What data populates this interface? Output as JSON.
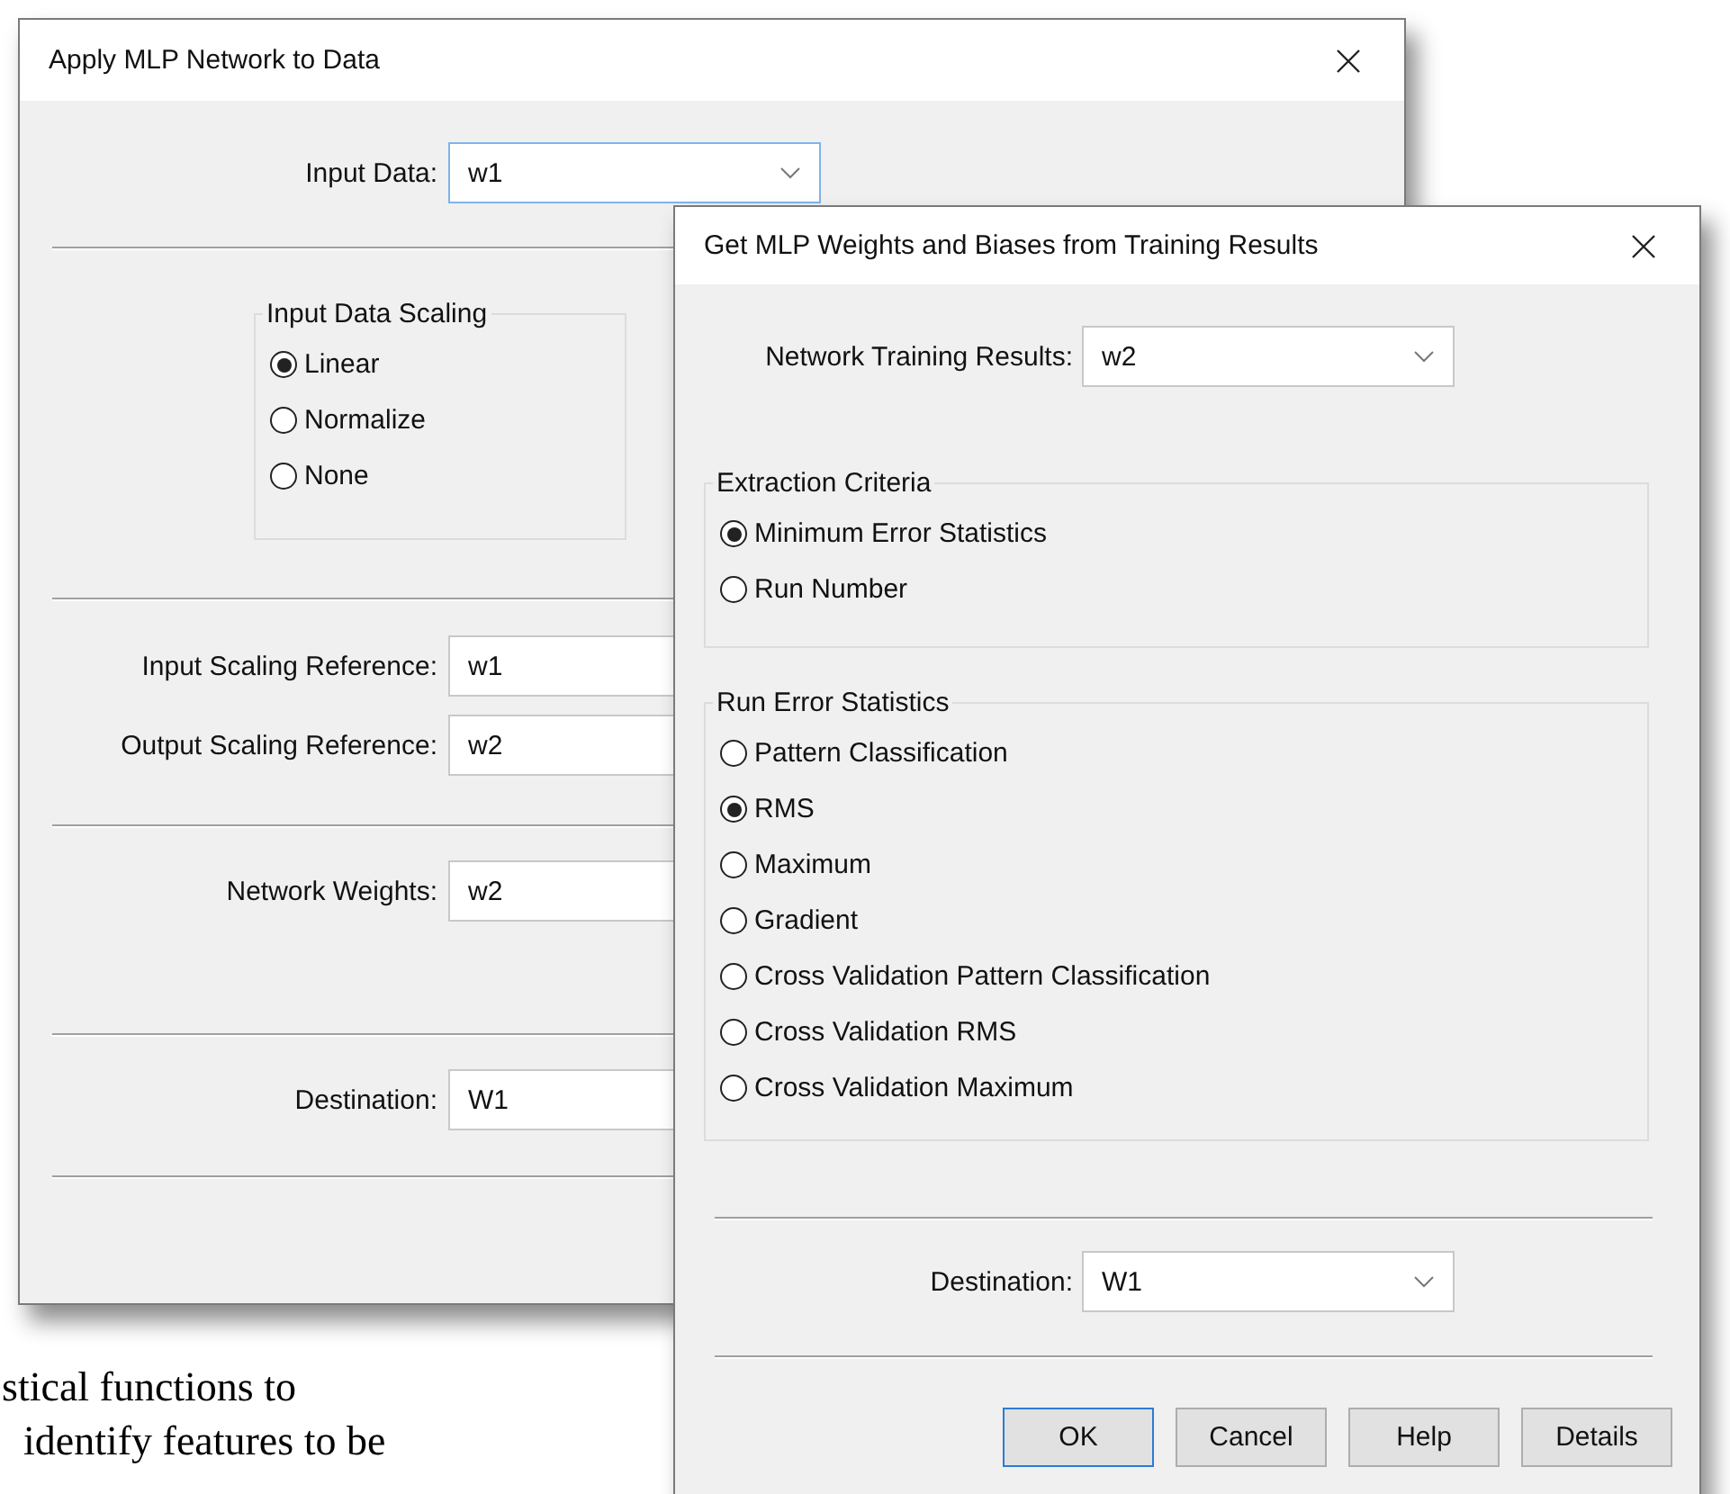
{
  "background_text": {
    "lines": [
      "stical functions to",
      "identify features to be"
    ]
  },
  "apply_dialog": {
    "title": "Apply MLP Network to Data",
    "input_data": {
      "label": "Input Data:",
      "value": "w1",
      "focused": true
    },
    "scaling_group": {
      "title": "Input Data Scaling",
      "options": [
        {
          "label": "Linear",
          "selected": true
        },
        {
          "label": "Normalize",
          "selected": false
        },
        {
          "label": "None",
          "selected": false
        }
      ]
    },
    "input_scaling_reference": {
      "label": "Input Scaling Reference:",
      "value": "w1",
      "focused": false
    },
    "output_scaling_reference": {
      "label": "Output Scaling Reference:",
      "value": "w2",
      "focused": false
    },
    "network_weights": {
      "label": "Network Weights:",
      "value": "w2",
      "focused": false
    },
    "destination": {
      "label": "Destination:",
      "value": "W1",
      "focused": false
    }
  },
  "weights_dialog": {
    "title": "Get MLP Weights and Biases from Training Results",
    "network_training_results": {
      "label": "Network Training Results:",
      "value": "w2",
      "focused": false
    },
    "extraction_criteria": {
      "title": "Extraction Criteria",
      "options": [
        {
          "label": "Minimum Error Statistics",
          "selected": true
        },
        {
          "label": "Run Number",
          "selected": false
        }
      ]
    },
    "run_error_statistics": {
      "title": "Run Error Statistics",
      "options": [
        {
          "label": "Pattern Classification",
          "selected": false
        },
        {
          "label": "RMS",
          "selected": true
        },
        {
          "label": "Maximum",
          "selected": false
        },
        {
          "label": "Gradient",
          "selected": false
        },
        {
          "label": "Cross Validation Pattern Classification",
          "selected": false
        },
        {
          "label": "Cross Validation RMS",
          "selected": false
        },
        {
          "label": "Cross Validation Maximum",
          "selected": false
        }
      ]
    },
    "destination": {
      "label": "Destination:",
      "value": "W1",
      "focused": false
    },
    "buttons": [
      {
        "label": "OK",
        "default": true
      },
      {
        "label": "Cancel",
        "default": false
      },
      {
        "label": "Help",
        "default": false
      },
      {
        "label": "Details",
        "default": false
      }
    ]
  }
}
